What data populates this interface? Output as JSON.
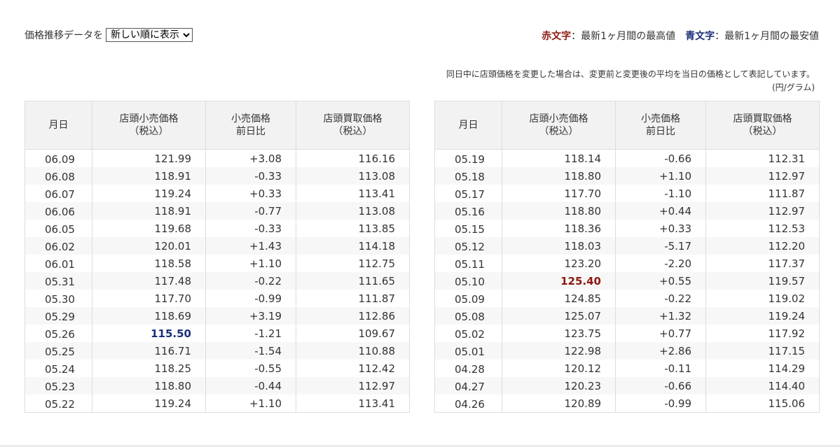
{
  "sort": {
    "label": "価格推移データを",
    "selected": "新しい順に表示"
  },
  "legend": {
    "red_label": "赤文字",
    "red_desc": "：最新1ヶ月間の最高値",
    "blue_label": "青文字",
    "blue_desc": "：最新1ヶ月間の最安値"
  },
  "note": {
    "text": "同日中に店頭価格を変更した場合は、変更前と変更後の平均を当日の価格として表記しています。",
    "unit": "(円/グラム)"
  },
  "headers": {
    "date": "月日",
    "retail": [
      "店頭小売価格",
      "（税込）"
    ],
    "diff": [
      "小売価格",
      "前日比"
    ],
    "buy": [
      "店頭買取価格",
      "（税込）"
    ]
  },
  "tables": [
    {
      "rows": [
        {
          "date": "06.09",
          "retail": "121.99",
          "diff": "+3.08",
          "buy": "116.16"
        },
        {
          "date": "06.08",
          "retail": "118.91",
          "diff": "-0.33",
          "buy": "113.08"
        },
        {
          "date": "06.07",
          "retail": "119.24",
          "diff": "+0.33",
          "buy": "113.41"
        },
        {
          "date": "06.06",
          "retail": "118.91",
          "diff": "-0.77",
          "buy": "113.08"
        },
        {
          "date": "06.05",
          "retail": "119.68",
          "diff": "-0.33",
          "buy": "113.85"
        },
        {
          "date": "06.02",
          "retail": "120.01",
          "diff": "+1.43",
          "buy": "114.18"
        },
        {
          "date": "06.01",
          "retail": "118.58",
          "diff": "+1.10",
          "buy": "112.75"
        },
        {
          "date": "05.31",
          "retail": "117.48",
          "diff": "-0.22",
          "buy": "111.65"
        },
        {
          "date": "05.30",
          "retail": "117.70",
          "diff": "-0.99",
          "buy": "111.87"
        },
        {
          "date": "05.29",
          "retail": "118.69",
          "diff": "+3.19",
          "buy": "112.86"
        },
        {
          "date": "05.26",
          "retail": "115.50",
          "diff": "-1.21",
          "buy": "109.67",
          "mark": "low"
        },
        {
          "date": "05.25",
          "retail": "116.71",
          "diff": "-1.54",
          "buy": "110.88"
        },
        {
          "date": "05.24",
          "retail": "118.25",
          "diff": "-0.55",
          "buy": "112.42"
        },
        {
          "date": "05.23",
          "retail": "118.80",
          "diff": "-0.44",
          "buy": "112.97"
        },
        {
          "date": "05.22",
          "retail": "119.24",
          "diff": "+1.10",
          "buy": "113.41"
        }
      ]
    },
    {
      "rows": [
        {
          "date": "05.19",
          "retail": "118.14",
          "diff": "-0.66",
          "buy": "112.31"
        },
        {
          "date": "05.18",
          "retail": "118.80",
          "diff": "+1.10",
          "buy": "112.97"
        },
        {
          "date": "05.17",
          "retail": "117.70",
          "diff": "-1.10",
          "buy": "111.87"
        },
        {
          "date": "05.16",
          "retail": "118.80",
          "diff": "+0.44",
          "buy": "112.97"
        },
        {
          "date": "05.15",
          "retail": "118.36",
          "diff": "+0.33",
          "buy": "112.53"
        },
        {
          "date": "05.12",
          "retail": "118.03",
          "diff": "-5.17",
          "buy": "112.20"
        },
        {
          "date": "05.11",
          "retail": "123.20",
          "diff": "-2.20",
          "buy": "117.37"
        },
        {
          "date": "05.10",
          "retail": "125.40",
          "diff": "+0.55",
          "buy": "119.57",
          "mark": "high"
        },
        {
          "date": "05.09",
          "retail": "124.85",
          "diff": "-0.22",
          "buy": "119.02"
        },
        {
          "date": "05.08",
          "retail": "125.07",
          "diff": "+1.32",
          "buy": "119.24"
        },
        {
          "date": "05.02",
          "retail": "123.75",
          "diff": "+0.77",
          "buy": "117.92"
        },
        {
          "date": "05.01",
          "retail": "122.98",
          "diff": "+2.86",
          "buy": "117.15"
        },
        {
          "date": "04.28",
          "retail": "120.12",
          "diff": "-0.11",
          "buy": "114.29"
        },
        {
          "date": "04.27",
          "retail": "120.23",
          "diff": "-0.66",
          "buy": "114.40"
        },
        {
          "date": "04.26",
          "retail": "120.89",
          "diff": "-0.99",
          "buy": "115.06"
        }
      ]
    }
  ],
  "colors": {
    "high": "#8b1a10",
    "low": "#1b2f7a"
  }
}
